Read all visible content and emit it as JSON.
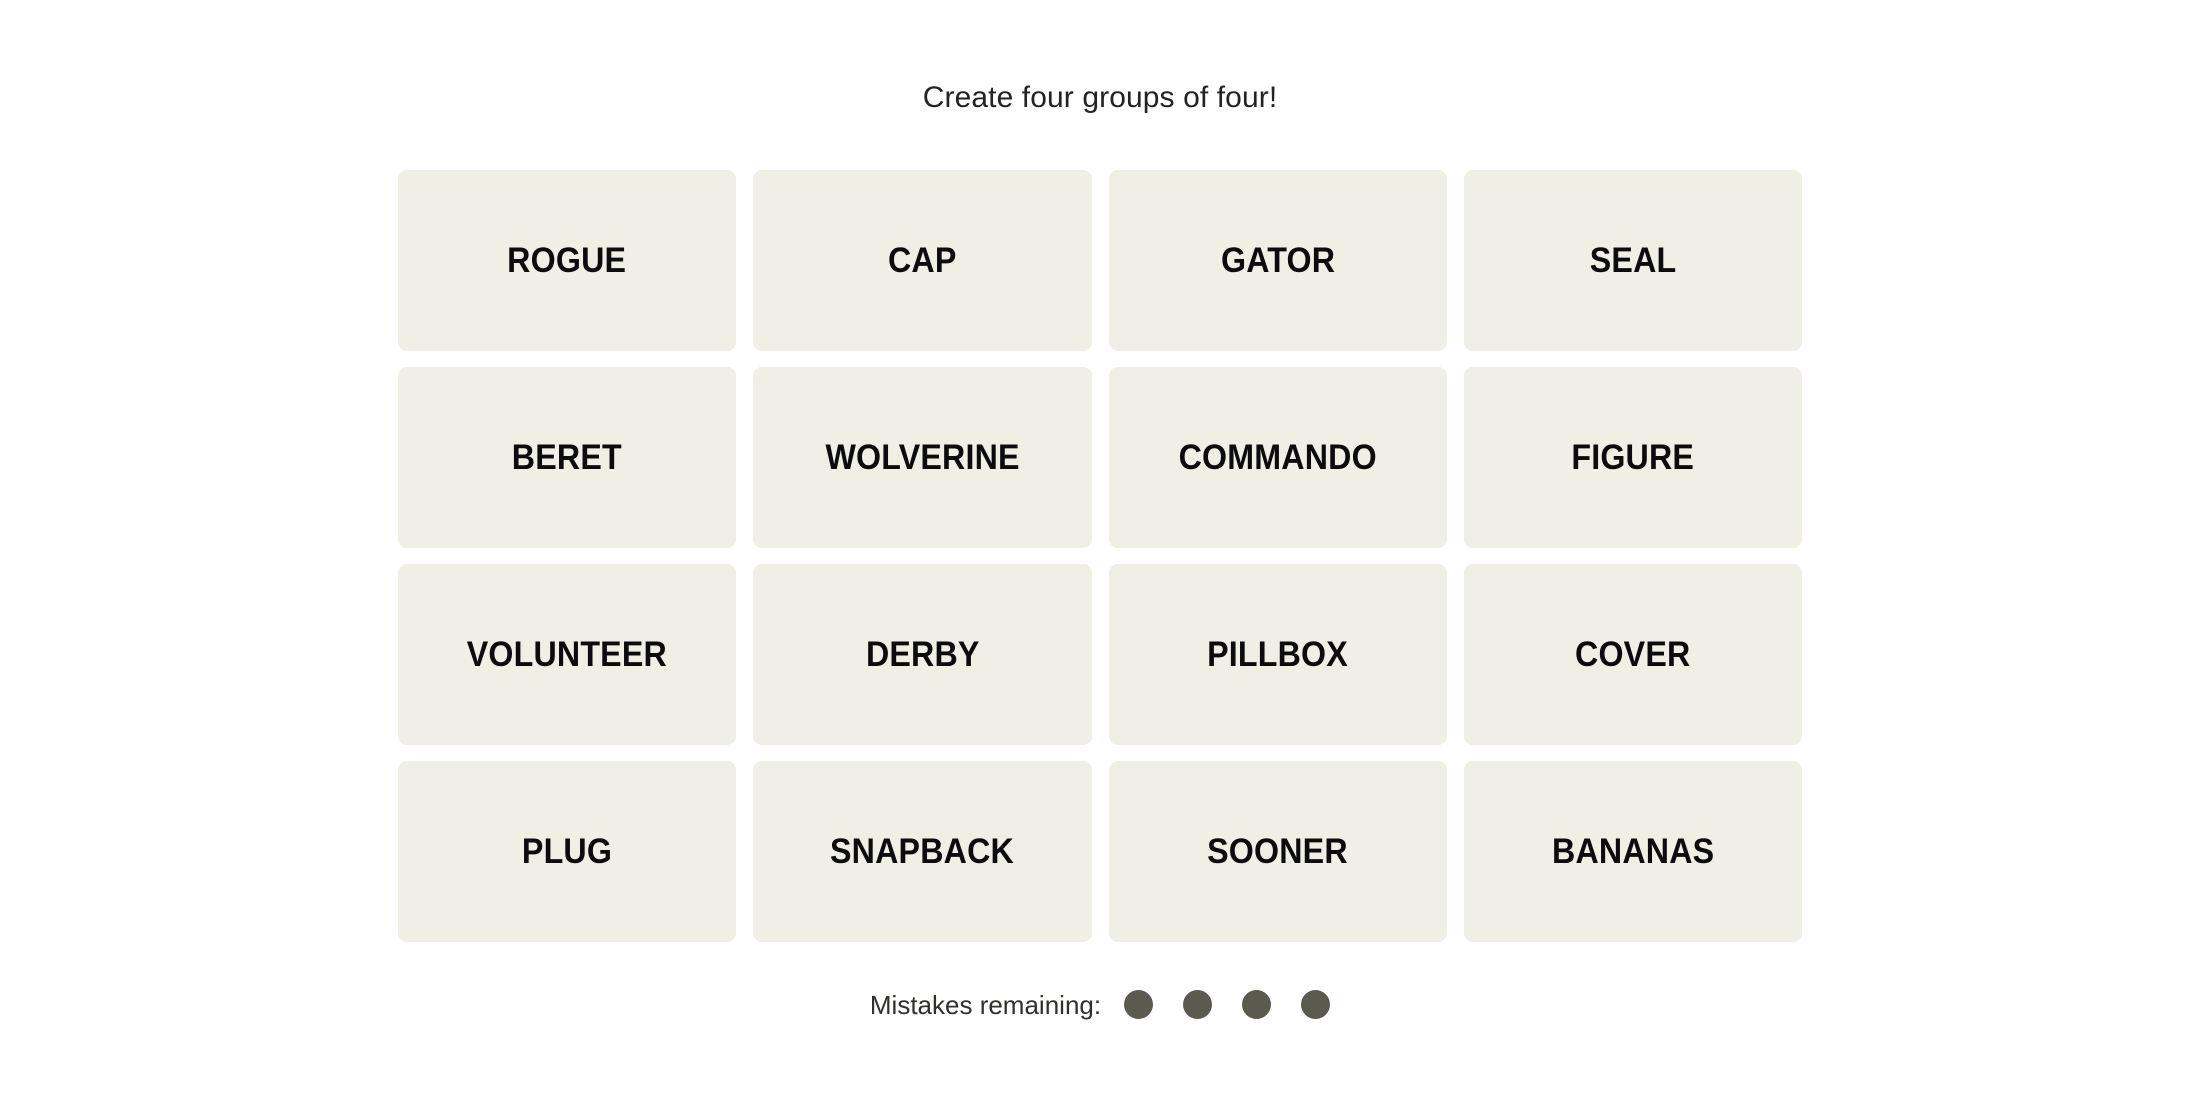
{
  "header": {
    "instruction": "Create four groups of four!"
  },
  "board": {
    "columns": 4,
    "rows": 4,
    "tile_color": "#efefe6",
    "tile_text_color": "#0c0c0c",
    "tiles": [
      {
        "label": "ROGUE"
      },
      {
        "label": "CAP"
      },
      {
        "label": "GATOR"
      },
      {
        "label": "SEAL"
      },
      {
        "label": "BERET"
      },
      {
        "label": "WOLVERINE"
      },
      {
        "label": "COMMANDO"
      },
      {
        "label": "FIGURE"
      },
      {
        "label": "VOLUNTEER"
      },
      {
        "label": "DERBY"
      },
      {
        "label": "PILLBOX"
      },
      {
        "label": "COVER"
      },
      {
        "label": "PLUG"
      },
      {
        "label": "SNAPBACK"
      },
      {
        "label": "SOONER"
      },
      {
        "label": "BANANAS"
      }
    ]
  },
  "footer": {
    "mistakes_label": "Mistakes remaining:",
    "mistakes_count": 4,
    "dot_color": "#5a5a4e",
    "dots": [
      {
        "name": "mistake-dot-1"
      },
      {
        "name": "mistake-dot-2"
      },
      {
        "name": "mistake-dot-3"
      },
      {
        "name": "mistake-dot-4"
      }
    ]
  }
}
